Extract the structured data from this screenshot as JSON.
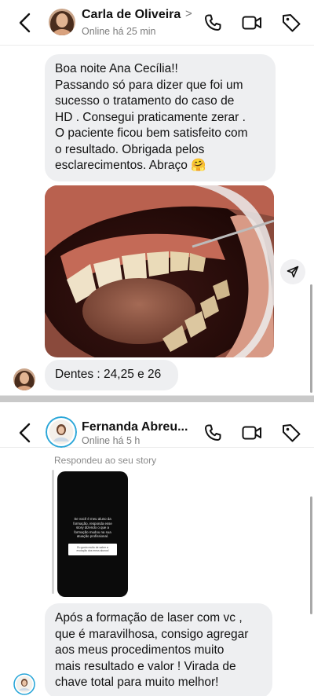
{
  "top_chat": {
    "header": {
      "contact_name": "Carla de Oliveira",
      "chevron": ">",
      "status": "Online há 25 min"
    },
    "messages": {
      "first": "Boa noite Ana Cecília!!\nPassando só para dizer que foi um\nsucesso o tratamento do caso de\nHD . Consegui praticamente zerar .\nO paciente ficou bem satisfeito com\no resultado. Obrigada pelos\nesclarecimentos. Abraço 🤗",
      "second": "Dentes : 24,25 e 26"
    },
    "icons": [
      "back-icon",
      "phone-icon",
      "video-icon",
      "tag-icon",
      "share-icon"
    ]
  },
  "bottom_chat": {
    "header": {
      "contact_name": "Fernanda Abreu...",
      "status": "Online há 5 h"
    },
    "replied_label": "Respondeu ao seu story",
    "story": {
      "text": "Se você é meu aluno da\nformação, responda esse\nstory dizendo o que a\nformação mudou na sua\natuação profissional.",
      "box_text": "Eu gosto muito de saber a\nevolução dos meus alunos!"
    },
    "message": "Após a formação de laser  com vc ,\nque é maravilhosa, consigo agregar\naos meus procedimentos muito\nmais resultado e valor ! Virada de\nchave total para muito melhor!",
    "icons": [
      "back-icon",
      "phone-icon",
      "video-icon",
      "tag-icon"
    ]
  },
  "colors": {
    "bubble": "#eeeff1",
    "divider": "#c9c9c9",
    "status_text": "#7c7c7c",
    "story_ring": "#2aa6d8"
  }
}
